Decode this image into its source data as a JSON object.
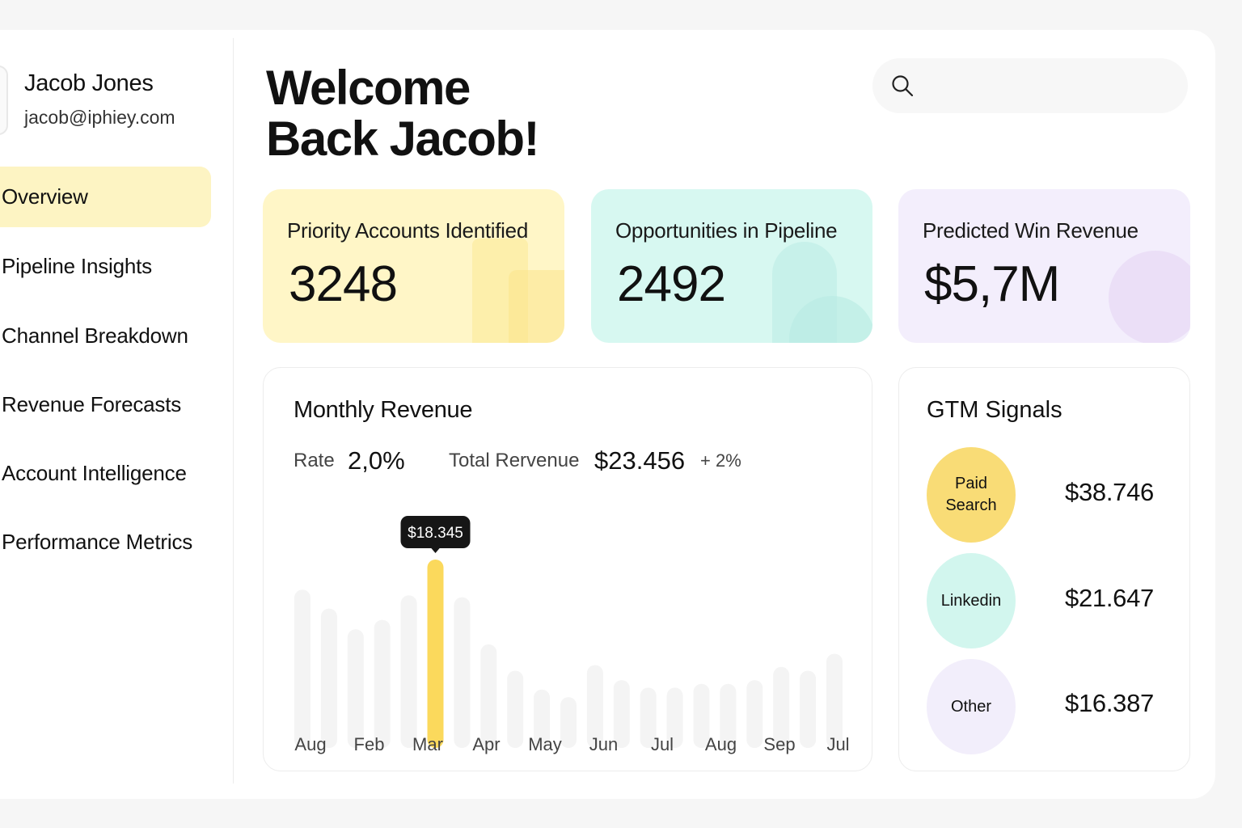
{
  "user": {
    "name": "Jacob Jones",
    "email": "jacob@iphiey.com"
  },
  "nav": {
    "items": [
      {
        "label": "Overview",
        "active": true
      },
      {
        "label": "Pipeline Insights",
        "active": false
      },
      {
        "label": "Channel Breakdown",
        "active": false
      },
      {
        "label": "Revenue Forecasts",
        "active": false
      },
      {
        "label": "Account Intelligence",
        "active": false
      },
      {
        "label": "Performance Metrics",
        "active": false
      }
    ]
  },
  "header": {
    "welcome_line1": "Welcome",
    "welcome_line2": "Back Jacob!",
    "search": {
      "placeholder": "",
      "value": "",
      "icon": "search-icon"
    }
  },
  "stats": [
    {
      "title": "Priority Accounts Identified",
      "value": "3248",
      "color": "#fff6c7"
    },
    {
      "title": "Opportunities in Pipeline",
      "value": "2492",
      "color": "#d7f8f1"
    },
    {
      "title": "Predicted Win Revenue",
      "value": "$5,7M",
      "color": "#f3eefc"
    }
  ],
  "monthly_revenue": {
    "title": "Monthly Revenue",
    "rate_label": "Rate",
    "rate_value": "2,0%",
    "total_label": "Total Rervenue",
    "total_value": "$23.456",
    "total_change": "+ 2%",
    "tooltip": "$18.345"
  },
  "chart_data": {
    "type": "bar",
    "x_labels": [
      "Aug",
      "Feb",
      "Mar",
      "Apr",
      "May",
      "Jun",
      "Jul",
      "Aug",
      "Sep",
      "Jul"
    ],
    "values": [
      0.84,
      0.74,
      0.63,
      0.68,
      0.81,
      1.0,
      0.8,
      0.55,
      0.41,
      0.31,
      0.27,
      0.44,
      0.36,
      0.32,
      0.32,
      0.34,
      0.34,
      0.36,
      0.43,
      0.41,
      0.5
    ],
    "highlight_index": 5,
    "highlight_label": "$18.345",
    "highlight_color": "#fbd95c",
    "bar_color": "#f4f4f4",
    "axes_visible": false,
    "grid": false
  },
  "gtm_signals": {
    "title": "GTM Signals",
    "items": [
      {
        "label": "Paid\nSearch",
        "value": "$38.746",
        "color": "#f9dc76"
      },
      {
        "label": "Linkedin",
        "value": "$21.647",
        "color": "#d2f6ee"
      },
      {
        "label": "Other",
        "value": "$16.387",
        "color": "#f2eefb"
      }
    ]
  }
}
